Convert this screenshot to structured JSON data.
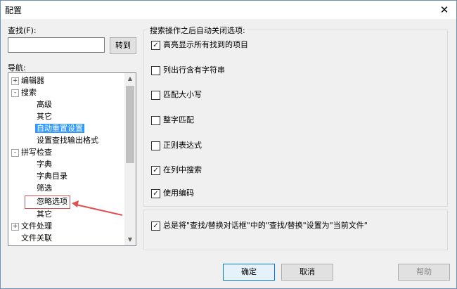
{
  "window": {
    "title": "配置",
    "close_glyph": "✕"
  },
  "find": {
    "label": "查找(F):",
    "value": "",
    "goto_label": "转到"
  },
  "nav": {
    "label": "导航:",
    "items": [
      {
        "label": "编辑器",
        "expander": "+"
      },
      {
        "label": "搜索",
        "expander": "-"
      },
      {
        "label": "高级"
      },
      {
        "label": "其它"
      },
      {
        "label": "自动重置设置",
        "selected": true
      },
      {
        "label": "设置查找输出格式"
      },
      {
        "label": "拼写检查",
        "expander": "-"
      },
      {
        "label": "字典"
      },
      {
        "label": "字典目录"
      },
      {
        "label": "筛选"
      },
      {
        "label": "忽略选项"
      },
      {
        "label": "其它"
      },
      {
        "label": "文件处理",
        "expander": "+"
      },
      {
        "label": "文件关联"
      }
    ]
  },
  "options": {
    "group_label": "搜索操作之后自动关闭选项:",
    "items": [
      {
        "label": "高亮显示所有找到的项目",
        "checked": "✓"
      },
      {
        "label": "列出行含有字符串",
        "checked": ""
      },
      {
        "label": "匹配大小写",
        "checked": ""
      },
      {
        "label": "整字匹配",
        "checked": ""
      },
      {
        "label": "正则表达式",
        "checked": ""
      },
      {
        "label": "在列中搜索",
        "checked": "✓"
      },
      {
        "label": "使用编码",
        "checked": "✓"
      }
    ],
    "global": {
      "label": "总是将\"查找/替换对话框\"中的\"查找/替换\"设置为\"当前文件\"",
      "checked": "✓"
    }
  },
  "buttons": {
    "ok": "确定",
    "cancel": "取消",
    "help": "帮助"
  },
  "colors": {
    "selection": "#3399ff",
    "annotation": "#e05050"
  }
}
